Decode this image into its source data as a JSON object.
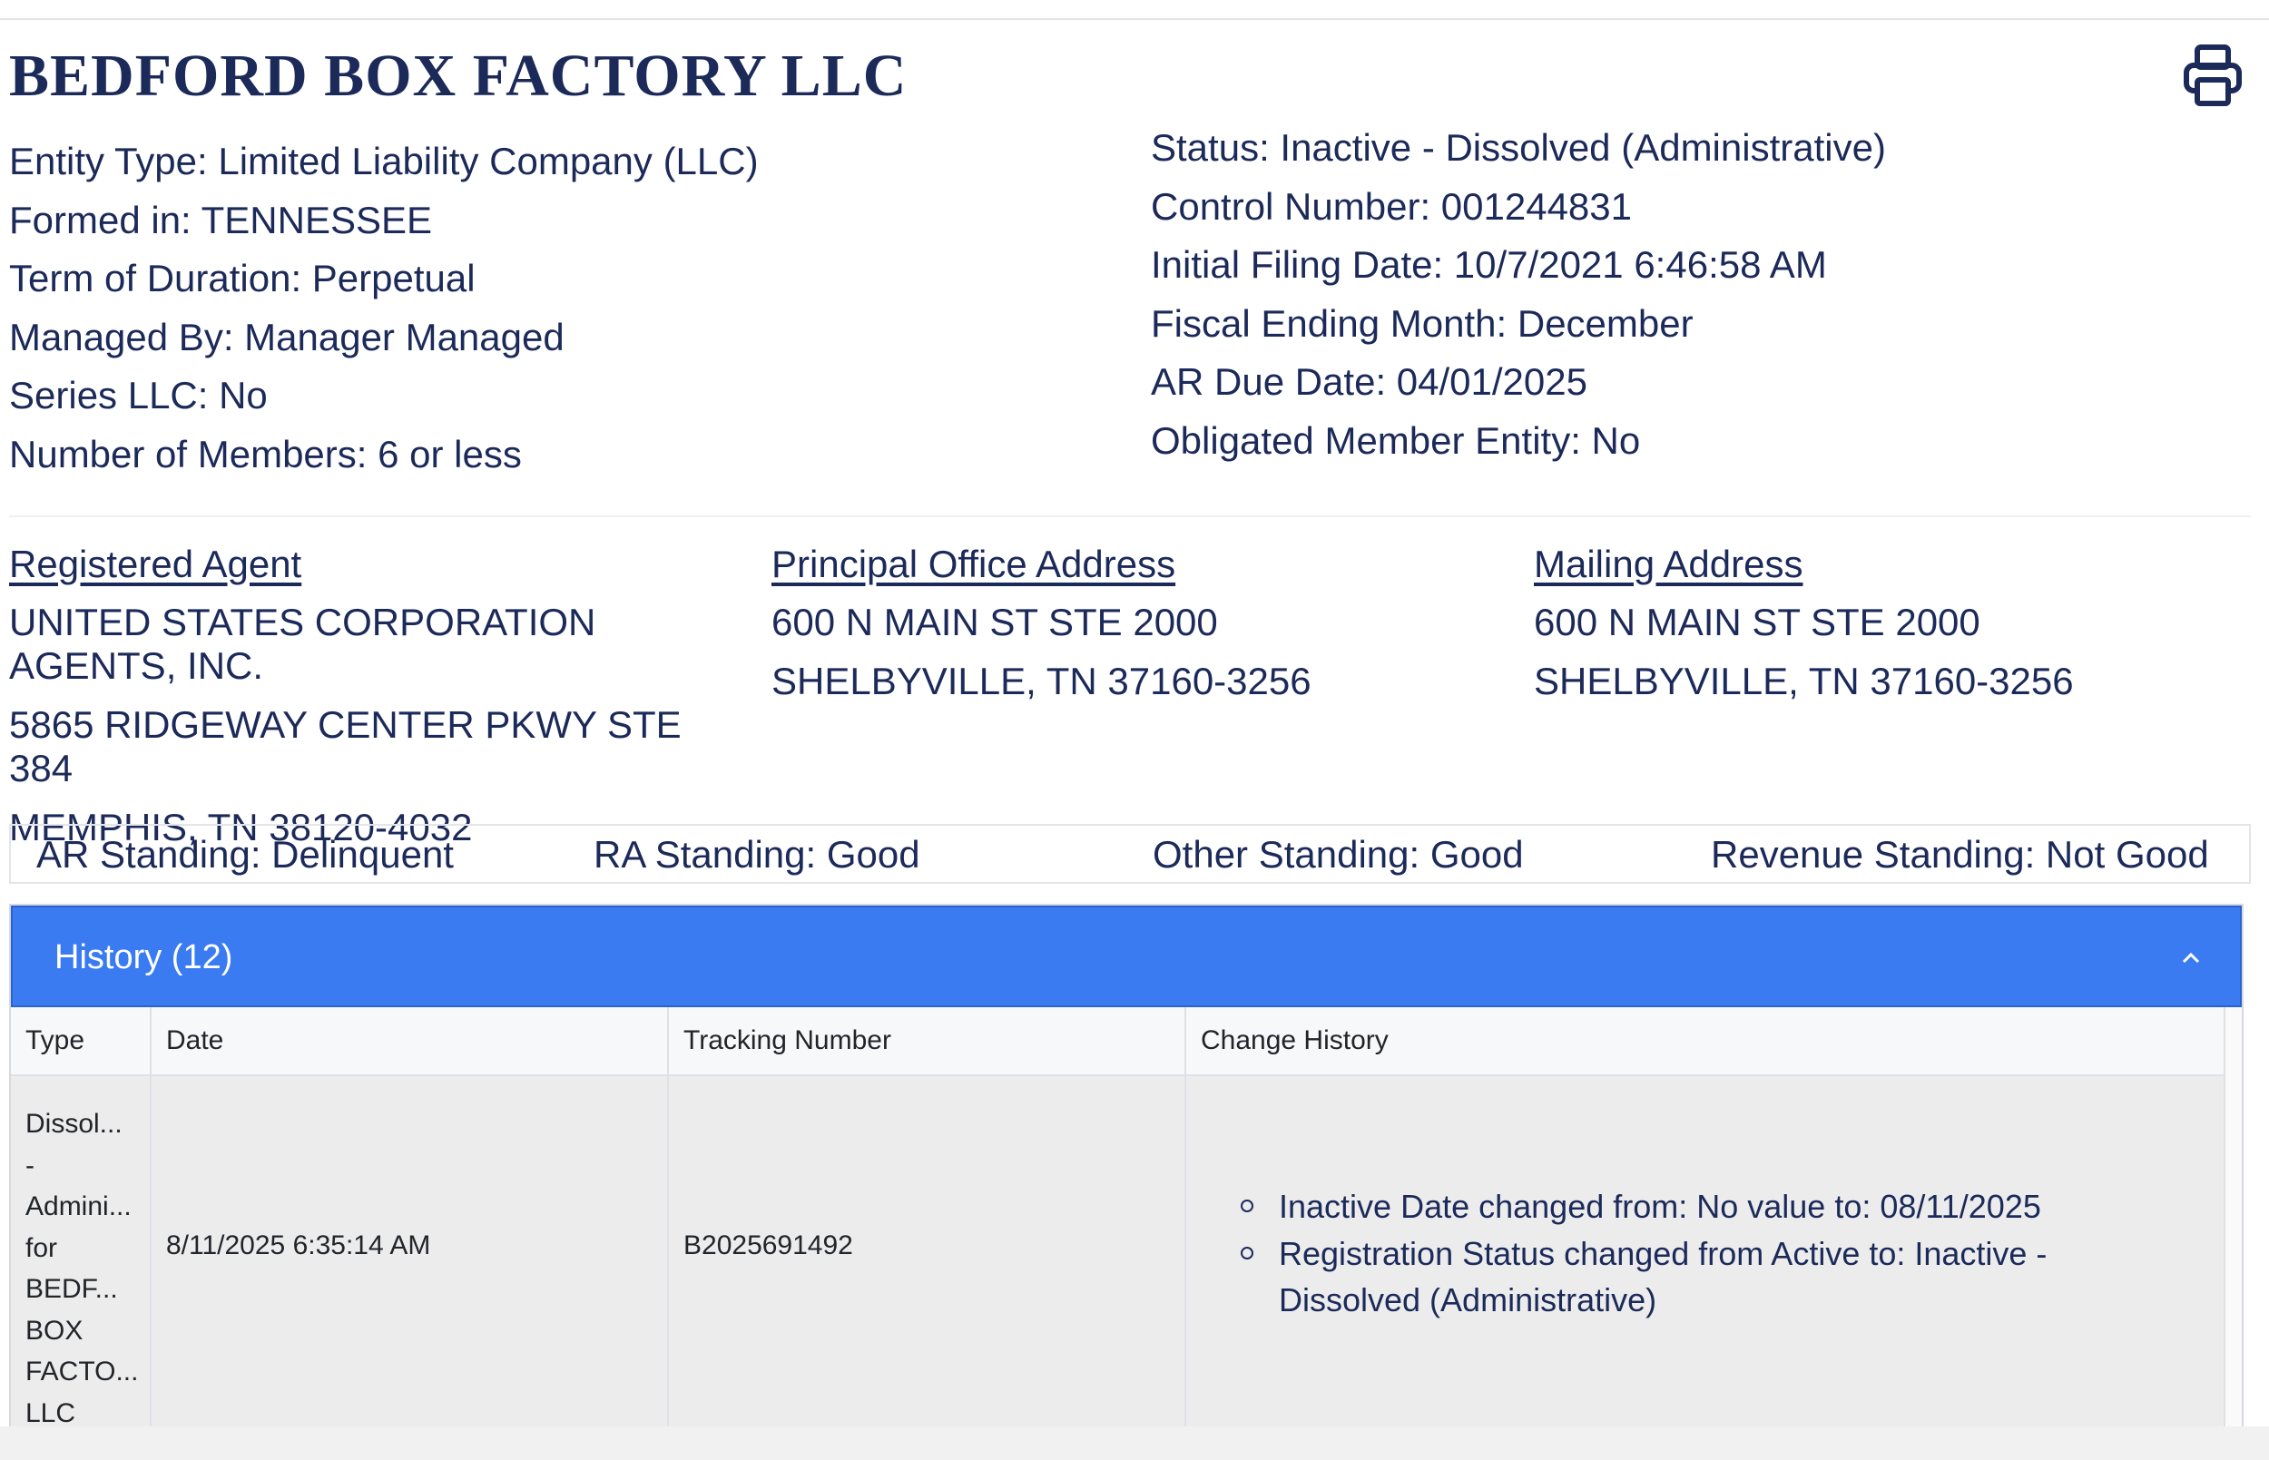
{
  "entity": {
    "name": "BEDFORD BOX FACTORY LLC",
    "left_details": [
      "Entity Type: Limited Liability Company (LLC)",
      "Formed in: TENNESSEE",
      "Term of Duration: Perpetual",
      "Managed By: Manager Managed",
      "Series LLC: No",
      "Number of Members: 6 or less"
    ],
    "right_details": [
      "Status: Inactive - Dissolved (Administrative)",
      "Control Number: 001244831",
      "Initial Filing Date: 10/7/2021 6:46:58 AM",
      "Fiscal Ending Month: December",
      "AR Due Date: 04/01/2025",
      "Obligated Member Entity: No"
    ]
  },
  "addresses": {
    "registered_agent": {
      "header": "Registered Agent",
      "lines": [
        "UNITED STATES CORPORATION AGENTS, INC.",
        "5865 RIDGEWAY CENTER PKWY STE 384",
        "MEMPHIS, TN 38120-4032"
      ]
    },
    "principal_office": {
      "header": "Principal Office Address",
      "lines": [
        "600 N MAIN ST STE 2000",
        "SHELBYVILLE, TN 37160-3256"
      ]
    },
    "mailing": {
      "header": "Mailing Address",
      "lines": [
        "600 N MAIN ST STE 2000",
        "SHELBYVILLE, TN 37160-3256"
      ]
    }
  },
  "standing": {
    "ar": "AR Standing: Delinquent",
    "ra": "RA Standing: Good",
    "other": "Other Standing: Good",
    "revenue": "Revenue Standing: Not Good"
  },
  "history": {
    "title": "History (12)",
    "columns": [
      "Type",
      "Date",
      "Tracking Number",
      "Change History"
    ],
    "rows": [
      {
        "type_lines": [
          "Dissol...",
          "-",
          "Admini...",
          "for",
          "BEDF...",
          "BOX",
          "FACTO...",
          "LLC"
        ],
        "date": "8/11/2025 6:35:14 AM",
        "tracking_number": "B2025691492",
        "changes": [
          "Inactive Date changed from: No value to: 08/11/2025",
          "Registration Status changed from Active to: Inactive - Dissolved (Administrative)"
        ]
      }
    ]
  },
  "icons": {
    "print": "printer-icon",
    "collapse": "chevron-up-icon"
  },
  "colors": {
    "brand_text": "#1c2a5a",
    "history_header": "#3a7bf2"
  }
}
